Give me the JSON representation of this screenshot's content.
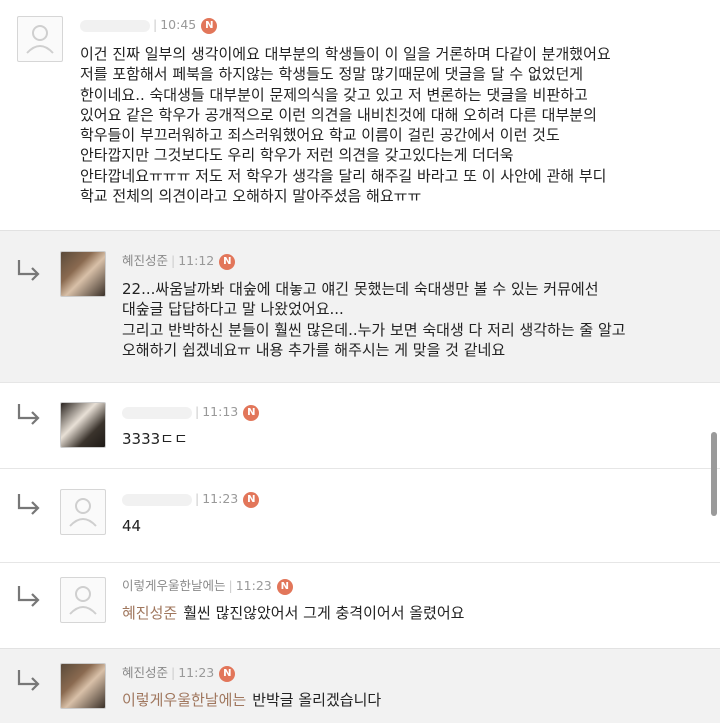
{
  "comments": [
    {
      "author": "",
      "time": "10:45",
      "badge": "N",
      "is_reply": false,
      "avatar": "default-avatar-icon",
      "lines": [
        "이건 진짜 일부의 생각이에요 대부분의 학생들이 이 일을 거론하며 다같이 분개했어요",
        "저를 포함해서 페북을 하지않는 학생들도 정말 많기때문에 댓글을 달 수 없었던게",
        "한이네요.. 숙대생들 대부분이 문제의식을 갖고 있고 저 변론하는 댓글을 비판하고",
        "있어요 같은 학우가 공개적으로 이런 의견을 내비친것에 대해 오히려 다른 대부분의",
        "학우들이 부끄러워하고 죄스러워했어요 학교 이름이 걸린 공간에서 이런 것도",
        "안타깝지만 그것보다도 우리 학우가 저런 의견을 갖고있다는게 더더욱",
        "안타깝네요ㅠㅠㅠ 저도 저 학우가 생각을 달리 해주길 바라고 또 이 사안에 관해 부디",
        "학교 전체의 의견이라고 오해하지 말아주셨음 해요ㅠㅠ"
      ]
    },
    {
      "author": "혜진성준",
      "time": "11:12",
      "badge": "N",
      "is_reply": true,
      "avatar": "profile-photo",
      "lines": [
        "22...싸움날까봐 대숲에 대놓고 얘긴 못했는데 숙대생만 볼 수 있는 커뮤에선",
        "대숲글 답답하다고 말 나왔었어요...",
        "그리고 반박하신 분들이 훨씬 많은데..누가 보면 숙대생 다 저리 생각하는 줄 알고",
        "오해하기 쉽겠네요ㅠ 내용 추가를 해주시는 게 맞을 것 같네요"
      ]
    },
    {
      "author": "",
      "time": "11:13",
      "badge": "N",
      "is_reply": true,
      "avatar": "profile-photo",
      "lines": [
        "3333ㄷㄷ"
      ]
    },
    {
      "author": "",
      "time": "11:23",
      "badge": "N",
      "is_reply": true,
      "avatar": "default-avatar-icon",
      "lines": [
        "44"
      ]
    },
    {
      "author": "이렇게우울한날에는",
      "time": "11:23",
      "badge": "N",
      "is_reply": true,
      "avatar": "default-avatar-icon",
      "mention": "혜진성준",
      "lines": [
        "훨씬 많진않았어서 그게 충격이어서 올렸어요"
      ]
    },
    {
      "author": "혜진성준",
      "time": "11:23",
      "badge": "N",
      "is_reply": true,
      "avatar": "profile-photo",
      "mention": "이렇게우울한날에는",
      "lines": [
        "반박글 올리겠습니다"
      ]
    }
  ],
  "colors": {
    "badge": "#e2765a",
    "mention": "#a0775e",
    "reply_bg": "#f2f2f2",
    "meta": "#999999"
  }
}
